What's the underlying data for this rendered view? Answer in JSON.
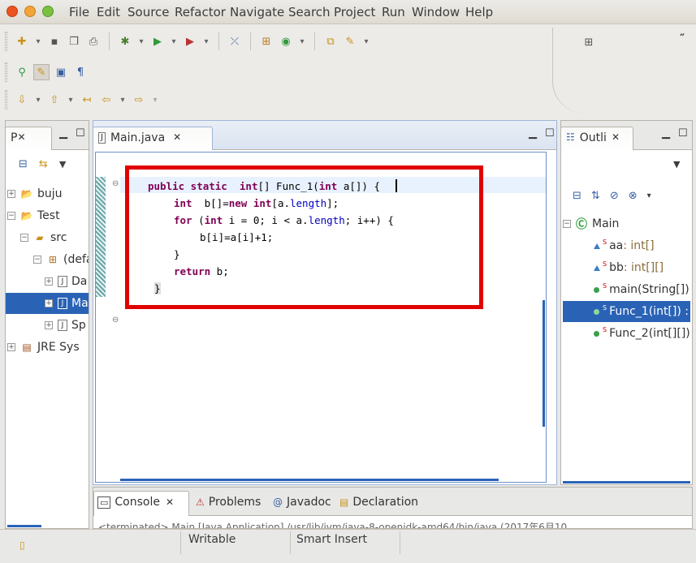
{
  "menu": {
    "items": [
      "File",
      "Edit",
      "Source",
      "Refactor",
      "Navigate",
      "Search",
      "Project",
      "Run",
      "Window",
      "Help"
    ]
  },
  "colors": {
    "accent": "#2a63b6",
    "highlight_box": "#e00000",
    "keyword": "#7f0055",
    "field": "#0000c0"
  },
  "explorer": {
    "tab_label": "P",
    "tree": [
      {
        "label": "buju",
        "icon": "project-icon"
      },
      {
        "label": "Test",
        "icon": "project-icon"
      },
      {
        "label": "src",
        "icon": "source-folder-icon"
      },
      {
        "label": "(defa",
        "icon": "package-icon"
      },
      {
        "label": "Da",
        "icon": "java-file-icon"
      },
      {
        "label": "Ma",
        "icon": "java-file-icon"
      },
      {
        "label": "Sp",
        "icon": "java-file-icon"
      },
      {
        "label": "JRE Sys",
        "icon": "library-icon"
      }
    ]
  },
  "editor": {
    "tab_label": "Main.java",
    "code": [
      "public static  int[] Func_1(int a[]) {",
      "    int  b[]=new int[a.length];",
      "    for (int i = 0; i < a.length; i++) {",
      "        b[i]=a[i]+1;",
      "    }",
      "    return b;",
      "}"
    ]
  },
  "outline": {
    "tab_label": "Outli",
    "items": [
      {
        "name": "Main",
        "type": ""
      },
      {
        "name": "aa",
        "type": " : int[]"
      },
      {
        "name": "bb",
        "type": " : int[][]"
      },
      {
        "name": "main(String[])",
        "type": ""
      },
      {
        "name": "Func_1(int[]) :",
        "type": ""
      },
      {
        "name": "Func_2(int[][])",
        "type": ""
      }
    ]
  },
  "bottom": {
    "tabs": [
      "Console",
      "Problems",
      "Javadoc",
      "Declaration"
    ],
    "console_text": "<terminated> Main [Java Application] /usr/lib/jvm/java-8-openjdk-amd64/bin/java (2017年6月10"
  },
  "status": {
    "writable": "Writable",
    "insert_mode": "Smart Insert"
  }
}
